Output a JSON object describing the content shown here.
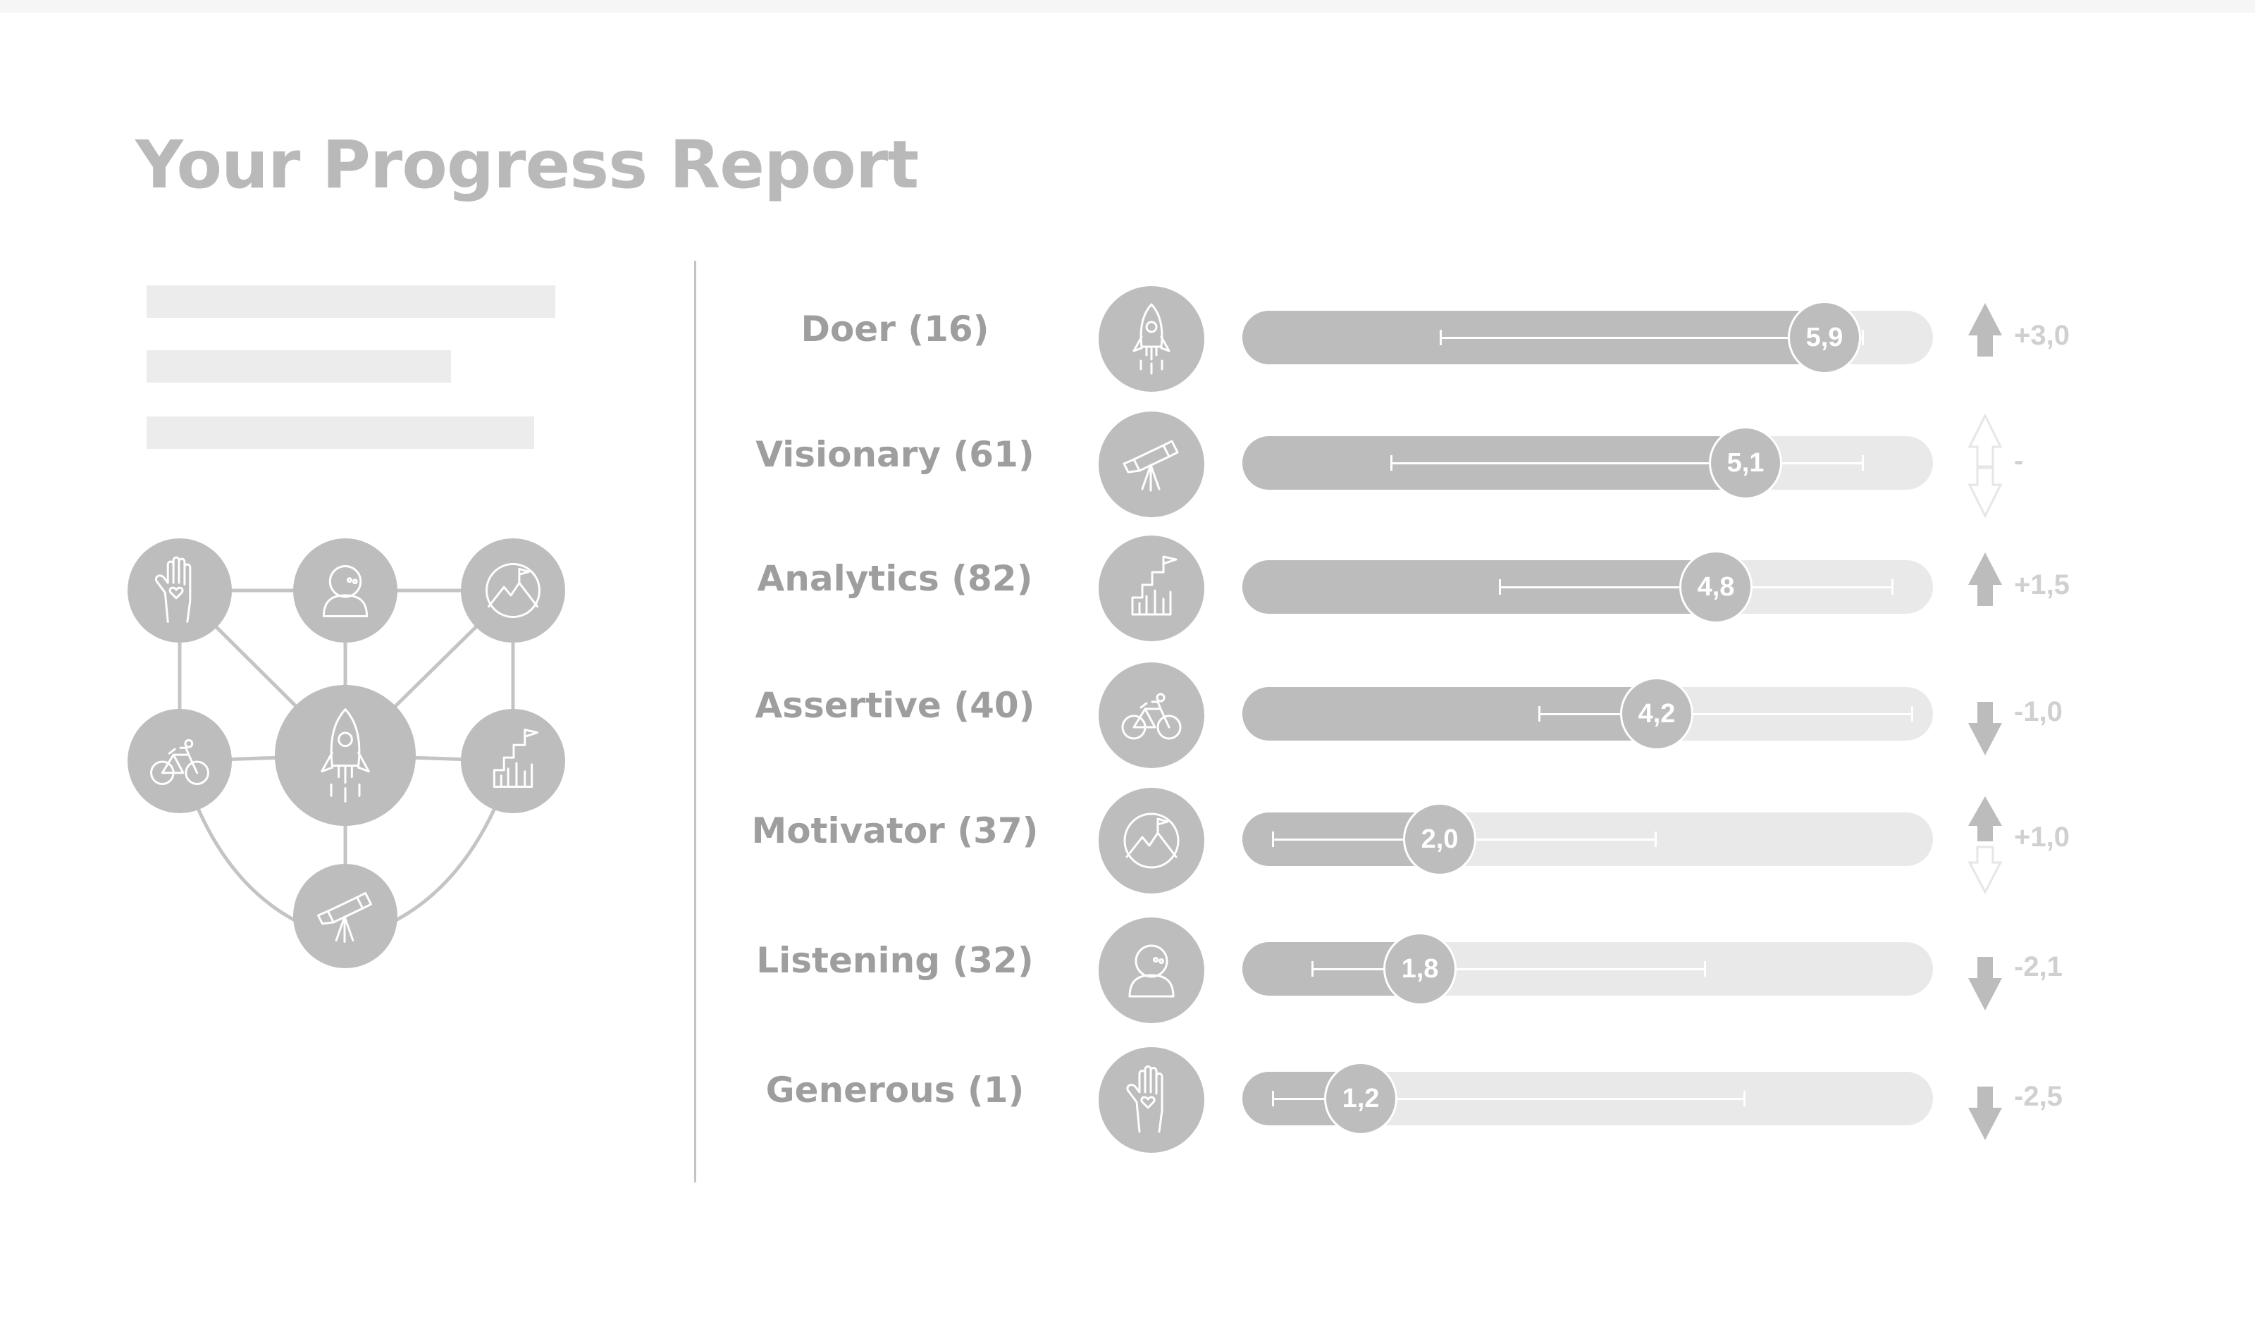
{
  "page": {
    "title": "Your Progress Report"
  },
  "colors": {
    "title": "#b9b9b9",
    "circle": "#bdbdbd",
    "line": "#c4c4c4",
    "track": "#e9e9e9",
    "fill": "#bcbcbc",
    "arrow": "#bcbcbc",
    "delta_text": "#d0d0d0",
    "placeholder": "#ececec"
  },
  "network": {
    "nodes": [
      {
        "name": "generous-node",
        "icon": "hand-heart-icon"
      },
      {
        "name": "listening-node",
        "icon": "person-icon"
      },
      {
        "name": "motivator-node",
        "icon": "mountain-flag-icon"
      },
      {
        "name": "assertive-node",
        "icon": "bicycle-icon"
      },
      {
        "name": "doer-node",
        "icon": "rocket-icon"
      },
      {
        "name": "analytics-node",
        "icon": "bar-blocks-flag-icon"
      },
      {
        "name": "visionary-node",
        "icon": "telescope-icon"
      }
    ]
  },
  "scale": {
    "min": 0,
    "max": 7
  },
  "rows": [
    {
      "key": "doer",
      "label": "Doer (16)",
      "icon": "rocket-icon",
      "value": 5.9,
      "value_label": "5,9",
      "range": [
        2.0,
        6.3
      ],
      "trend": "up",
      "delta": "+3,0"
    },
    {
      "key": "visionary",
      "label": "Visionary (61)",
      "icon": "telescope-icon",
      "value": 5.1,
      "value_label": "5,1",
      "range": [
        1.5,
        6.3
      ],
      "trend": "none",
      "delta": "-"
    },
    {
      "key": "analytics",
      "label": "Analytics (82)",
      "icon": "bar-blocks-flag-icon",
      "value": 4.8,
      "value_label": "4,8",
      "range": [
        2.6,
        6.6
      ],
      "trend": "up",
      "delta": "+1,5"
    },
    {
      "key": "assertive",
      "label": "Assertive (40)",
      "icon": "bicycle-icon",
      "value": 4.2,
      "value_label": "4,2",
      "range": [
        3.0,
        6.8
      ],
      "trend": "down",
      "delta": "-1,0"
    },
    {
      "key": "motivator",
      "label": "Motivator (37)",
      "icon": "mountain-flag-icon",
      "value": 2.0,
      "value_label": "2,0",
      "range": [
        0.3,
        4.2
      ],
      "trend": "up-mixed",
      "delta": "+1,0"
    },
    {
      "key": "listening",
      "label": "Listening (32)",
      "icon": "person-icon",
      "value": 1.8,
      "value_label": "1,8",
      "range": [
        0.7,
        4.7
      ],
      "trend": "down",
      "delta": "-2,1"
    },
    {
      "key": "generous",
      "label": "Generous (1)",
      "icon": "hand-heart-icon",
      "value": 1.2,
      "value_label": "1,2",
      "range": [
        0.3,
        5.1
      ],
      "trend": "down",
      "delta": "-2,5"
    }
  ]
}
